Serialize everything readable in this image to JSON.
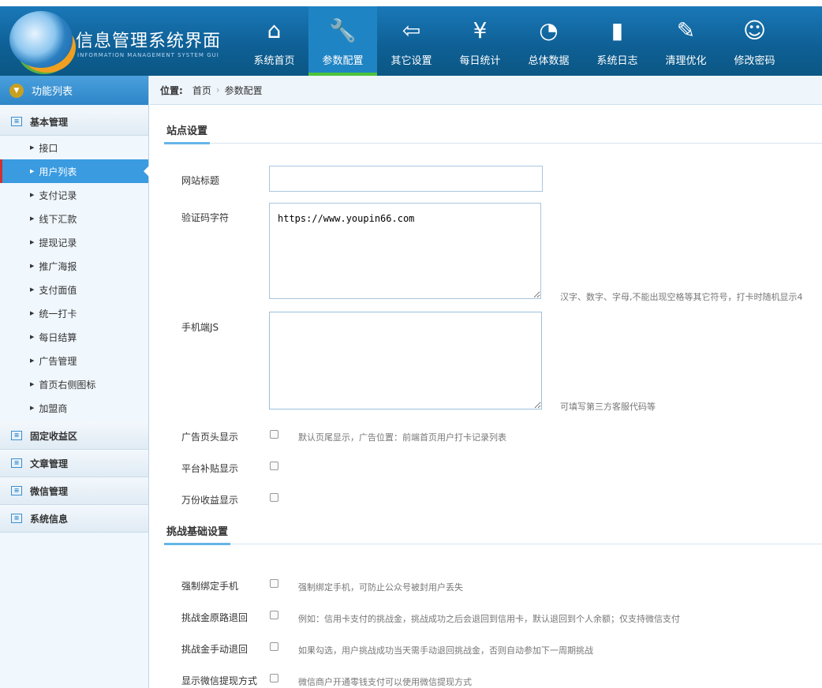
{
  "header": {
    "title": "信息管理系统界面",
    "subtitle": "INFORMATION MANAGEMENT SYSTEM GUI",
    "nav": [
      {
        "label": "系统首页",
        "icon": "home-icon",
        "glyph": "⌂"
      },
      {
        "label": "参数配置",
        "icon": "tools-icon",
        "glyph": "🔧"
      },
      {
        "label": "其它设置",
        "icon": "exit-icon",
        "glyph": "⇦"
      },
      {
        "label": "每日统计",
        "icon": "yen-icon",
        "glyph": "¥"
      },
      {
        "label": "总体数据",
        "icon": "pie-chart-icon",
        "glyph": "◔"
      },
      {
        "label": "系统日志",
        "icon": "book-icon",
        "glyph": "▮"
      },
      {
        "label": "清理优化",
        "icon": "pencil-ruler-icon",
        "glyph": "✎"
      },
      {
        "label": "修改密码",
        "icon": "user-icon",
        "glyph": "☺"
      }
    ],
    "active": 1
  },
  "sidebar": {
    "title": "功能列表",
    "groups": [
      {
        "label": "基本管理",
        "items": [
          "接口",
          "用户列表",
          "支付记录",
          "线下汇款",
          "提现记录",
          "推广海报",
          "支付面值",
          "统一打卡",
          "每日结算",
          "广告管理",
          "首页右侧图标",
          "加盟商"
        ]
      },
      {
        "label": "固定收益区"
      },
      {
        "label": "文章管理"
      },
      {
        "label": "微信管理"
      },
      {
        "label": "系统信息"
      }
    ],
    "active_item": "用户列表"
  },
  "breadcrumb": {
    "prefix": "位置:",
    "items": [
      "首页",
      "参数配置"
    ]
  },
  "site": {
    "title": "站点设置",
    "site_title_label": "网站标题",
    "site_title_value": "",
    "captcha_label": "验证码字符",
    "captcha_value": "https://www.youpin66.com",
    "captcha_hint": "汉字、数字、字母,不能出现空格等其它符号，打卡时随机显示4",
    "js_label": "手机端JS",
    "js_hint": "可填写第三方客服代码等",
    "ad_label": "广告页头显示",
    "ad_hint": "默认页尾显示，广告位置：前端首页用户打卡记录列表",
    "subsidy_label": "平台补贴显示",
    "wanfen_label": "万份收益显示"
  },
  "challenge": {
    "title": "挑战基础设置",
    "rows": [
      {
        "label": "强制绑定手机",
        "hint": "强制绑定手机，可防止公众号被封用户丢失"
      },
      {
        "label": "挑战金原路退回",
        "hint": "例如：信用卡支付的挑战金，挑战成功之后会退回到信用卡，默认退回到个人余额；仅支持微信支付"
      },
      {
        "label": "挑战金手动退回",
        "hint": "如果勾选，用户挑战成功当天需手动退回挑战金，否则自动参加下一周期挑战"
      },
      {
        "label": "显示微信提现方式",
        "hint": "微信商户开通零钱支付可以使用微信提现方式"
      }
    ]
  }
}
